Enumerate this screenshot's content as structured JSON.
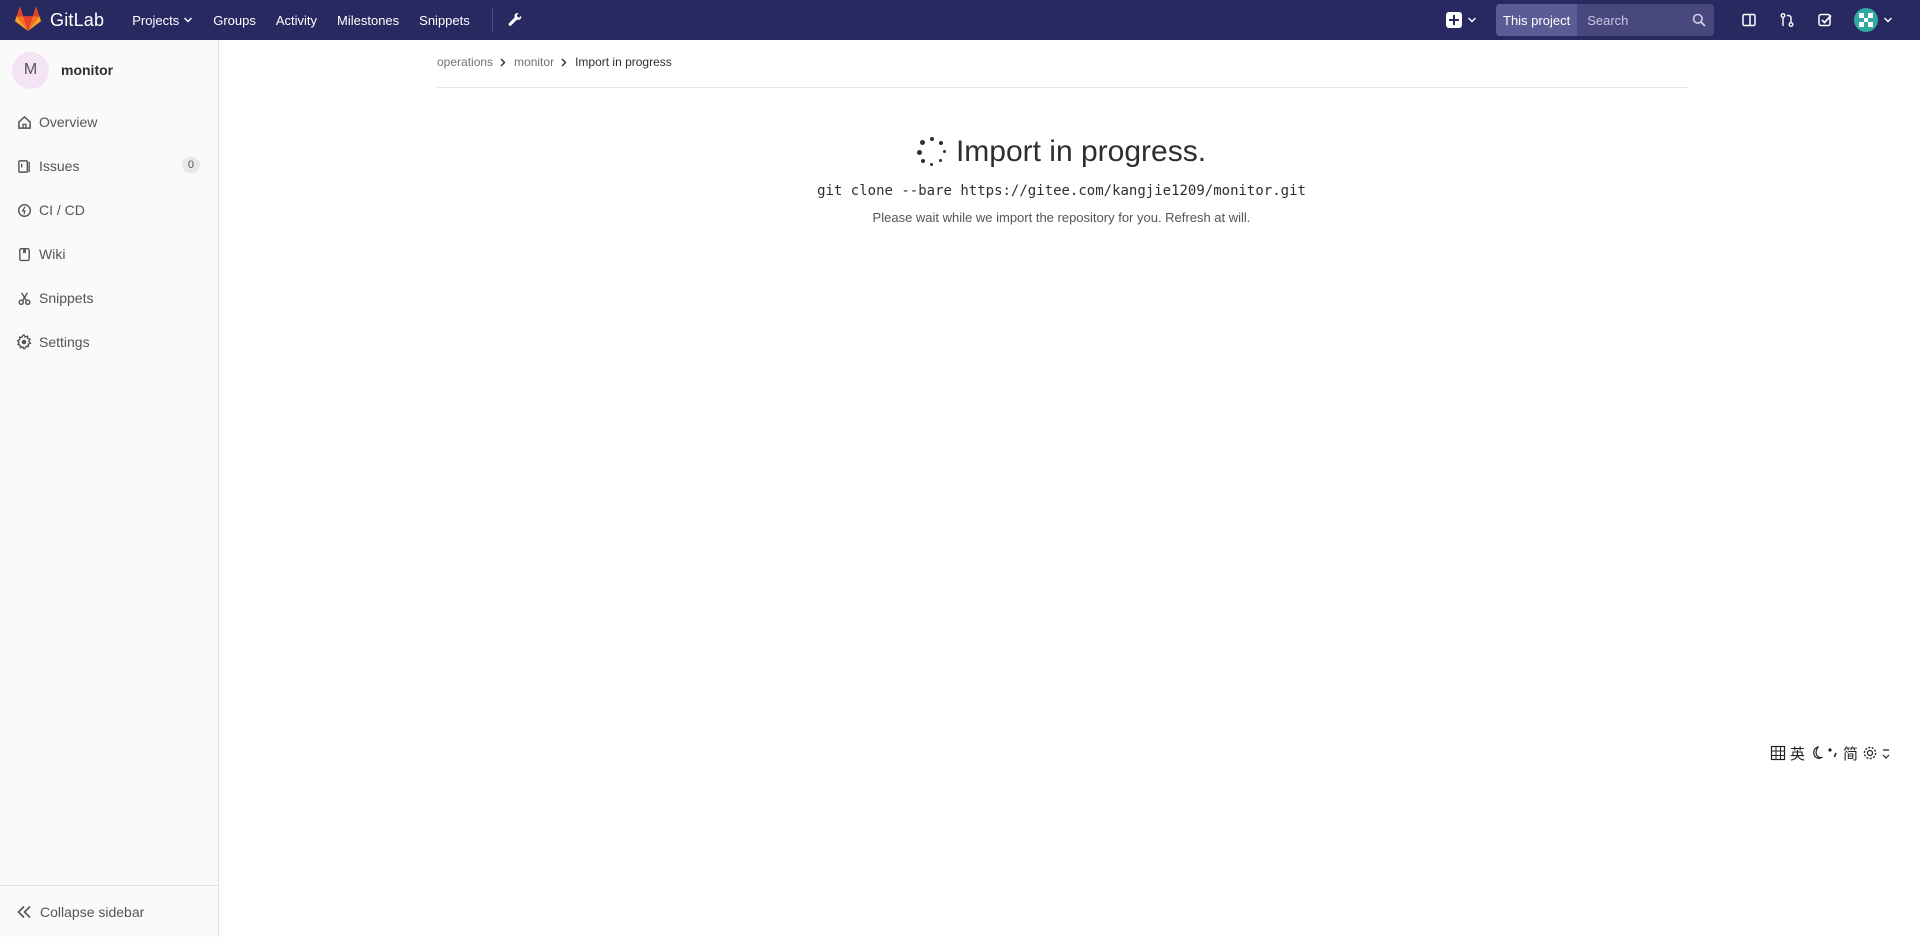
{
  "navbar": {
    "brand": "GitLab",
    "links": [
      "Projects",
      "Groups",
      "Activity",
      "Milestones",
      "Snippets"
    ],
    "search_scope": "This project",
    "search_placeholder": "Search"
  },
  "sidebar": {
    "project_initial": "M",
    "project_name": "monitor",
    "items": [
      {
        "label": "Overview",
        "icon": "home-icon"
      },
      {
        "label": "Issues",
        "icon": "issues-icon",
        "count": "0"
      },
      {
        "label": "CI / CD",
        "icon": "rocket-icon"
      },
      {
        "label": "Wiki",
        "icon": "book-icon"
      },
      {
        "label": "Snippets",
        "icon": "scissors-icon"
      },
      {
        "label": "Settings",
        "icon": "gear-icon"
      }
    ],
    "collapse_label": "Collapse sidebar"
  },
  "breadcrumbs": {
    "items": [
      "operations",
      "monitor"
    ],
    "current": "Import in progress"
  },
  "import": {
    "title": "Import in progress.",
    "command": "git clone --bare https://gitee.com/kangjie1209/monitor.git",
    "message": "Please wait while we import the repository for you. Refresh at will."
  },
  "ime": {
    "glyphs": [
      "英",
      "简"
    ]
  }
}
